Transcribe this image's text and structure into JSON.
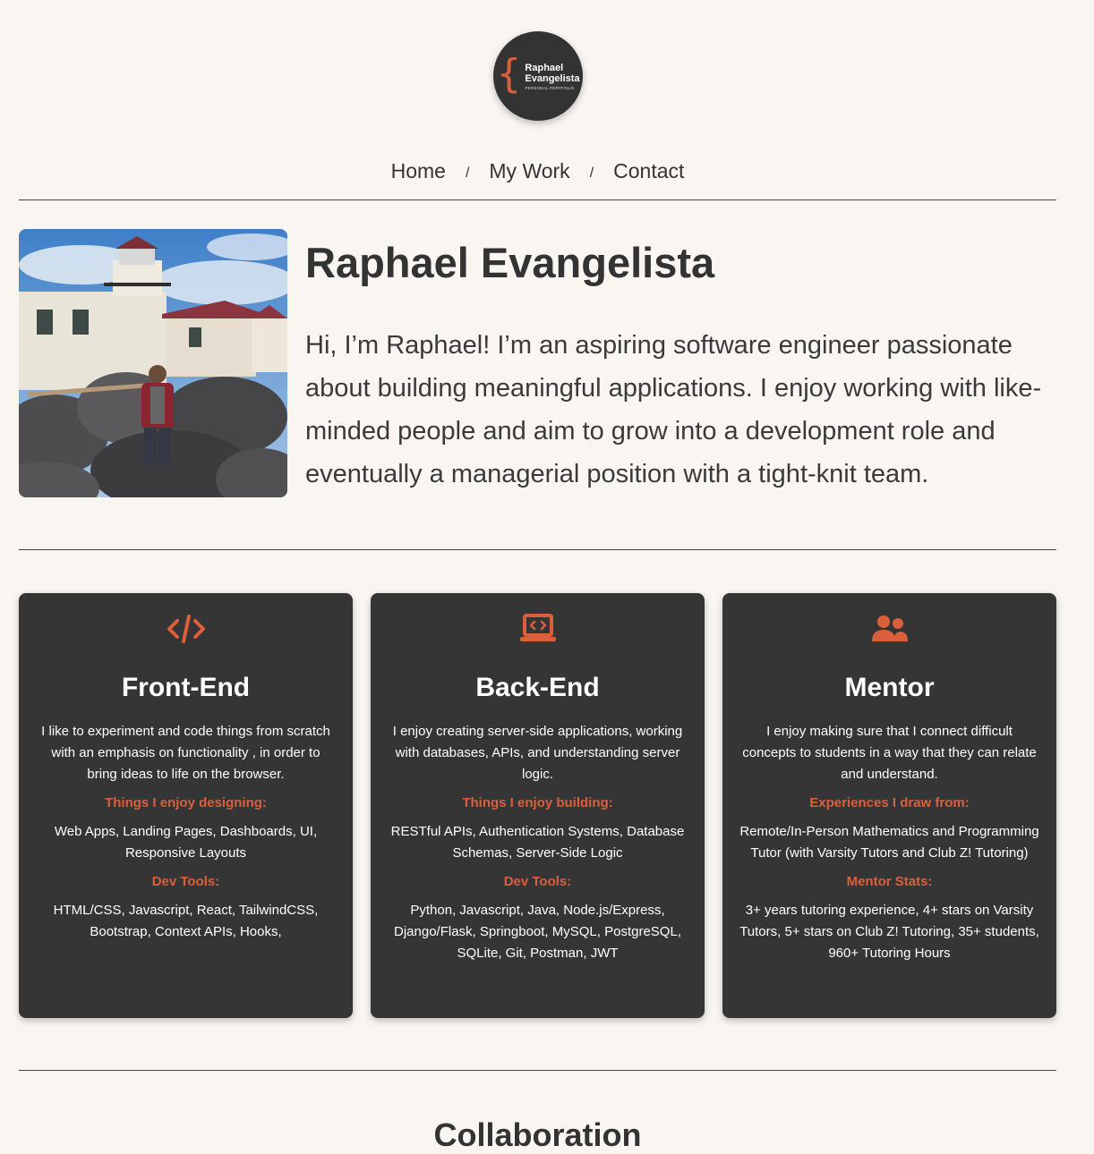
{
  "logo": {
    "line1": "Raphael",
    "line2": "Evangelista",
    "line3": "PERSONAL PORTFOLIO",
    "brace": "{"
  },
  "nav": {
    "home": "Home",
    "work": "My Work",
    "contact": "Contact",
    "separator": "/"
  },
  "hero": {
    "name": "Raphael Evangelista",
    "bio": "Hi, I’m Raphael! I’m an aspiring software engineer passionate about building meaningful applications. I enjoy working with like-minded people and aim to grow into a development role and eventually a managerial position with a tight-knit team."
  },
  "cards": [
    {
      "icon": "code-icon",
      "title": "Front-End",
      "description": "I like to experiment and code things from scratch with an emphasis on functionality , in order to bring ideas to life on the browser.",
      "section1_label": "Things I enjoy designing:",
      "section1_value": "Web Apps, Landing Pages, Dashboards, UI, Responsive Layouts",
      "section2_label": "Dev Tools:",
      "section2_value": "HTML/CSS, Javascript, React, TailwindCSS, Bootstrap, Context APIs, Hooks,"
    },
    {
      "icon": "laptop-code-icon",
      "title": "Back-End",
      "description": "I enjoy creating server-side applications, working with databases, APIs, and understanding server logic.",
      "section1_label": "Things I enjoy building:",
      "section1_value": "RESTful APIs, Authentication Systems, Database Schemas, Server-Side Logic",
      "section2_label": "Dev Tools:",
      "section2_value": "Python, Javascript, Java, Node.js/Express, Django/Flask, Springboot, MySQL, PostgreSQL, SQLite, Git, Postman, JWT"
    },
    {
      "icon": "users-icon",
      "title": "Mentor",
      "description": "I enjoy making sure that I connect difficult concepts to students in a way that they can relate and understand.",
      "section1_label": "Experiences I draw from:",
      "section1_value": "Remote/In-Person Mathematics and Programming Tutor (with Varsity Tutors and Club Z! Tutoring)",
      "section2_label": "Mentor Stats:",
      "section2_value": "3+ years tutoring experience, 4+ stars on Varsity Tutors, 5+ stars on Club Z! Tutoring, 35+ students, 960+ Tutoring Hours"
    }
  ],
  "collaboration": {
    "title": "Collaboration"
  },
  "colors": {
    "accent": "#d9603b",
    "card_bg": "#353535",
    "page_bg": "#f9f6f2",
    "text": "#333333"
  }
}
